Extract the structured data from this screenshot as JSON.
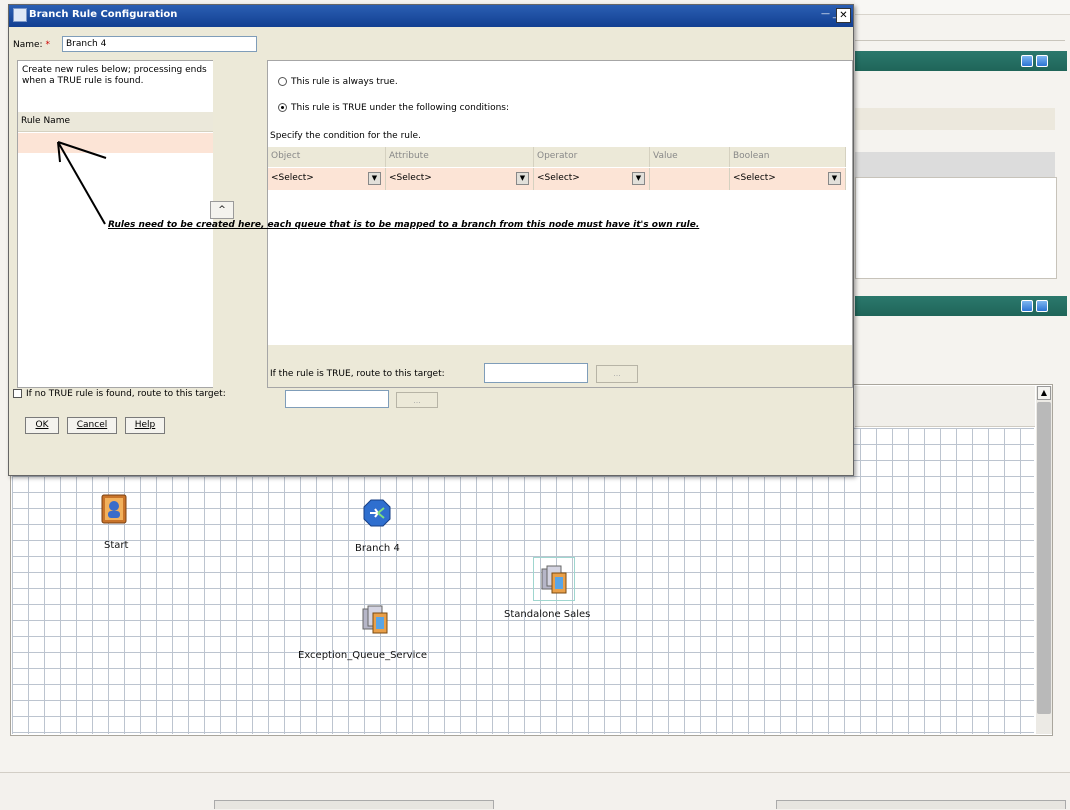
{
  "dialog": {
    "title": "Branch Rule Configuration",
    "title_controls": "— _",
    "close_glyph": "✕",
    "name_label": "Name:",
    "required_marker": "*",
    "name_value": "Branch 4",
    "intro_text": "Create new rules below; processing ends when a TRUE rule is found.",
    "rule_list_header": "Rule Name",
    "move_up_glyph": "^",
    "radio_always": "This rule is always true.",
    "radio_conditions": "This rule is TRUE under the following conditions:",
    "specify_text": "Specify the condition for the rule.",
    "columns": [
      "Object",
      "Attribute",
      "Operator",
      "Value",
      "Boolean"
    ],
    "selects": {
      "object": "<Select>",
      "attribute": "<Select>",
      "operator": "<Select>",
      "boolean": "<Select>"
    },
    "route_true_label": "If the rule is TRUE, route to this target:",
    "route_true_button": "...",
    "no_true_label": "If no TRUE rule is found, route to this target:",
    "no_true_button": "...",
    "buttons": {
      "ok": "OK",
      "cancel": "Cancel",
      "help": "Help"
    }
  },
  "annotation": {
    "text": "Rules need to be created here, each queue that is to be mapped to a branch from this node must have it's own rule."
  },
  "canvas": {
    "nodes": [
      {
        "label": "Start",
        "icon": "start-node-icon"
      },
      {
        "label": "Branch 4",
        "icon": "branch-node-icon"
      },
      {
        "label": "Standalone Sales",
        "icon": "queue-service-icon"
      },
      {
        "label": "Exception_Queue_Service",
        "icon": "queue-service-icon"
      }
    ]
  },
  "scroll": {
    "up_glyph": "▲",
    "down_glyph": "▼"
  },
  "colors": {
    "title_bar": "#1a4ea1",
    "panel_header": "#1f6559",
    "selected_row": "#fce4d6",
    "grid_line": "#bcc4cf"
  }
}
